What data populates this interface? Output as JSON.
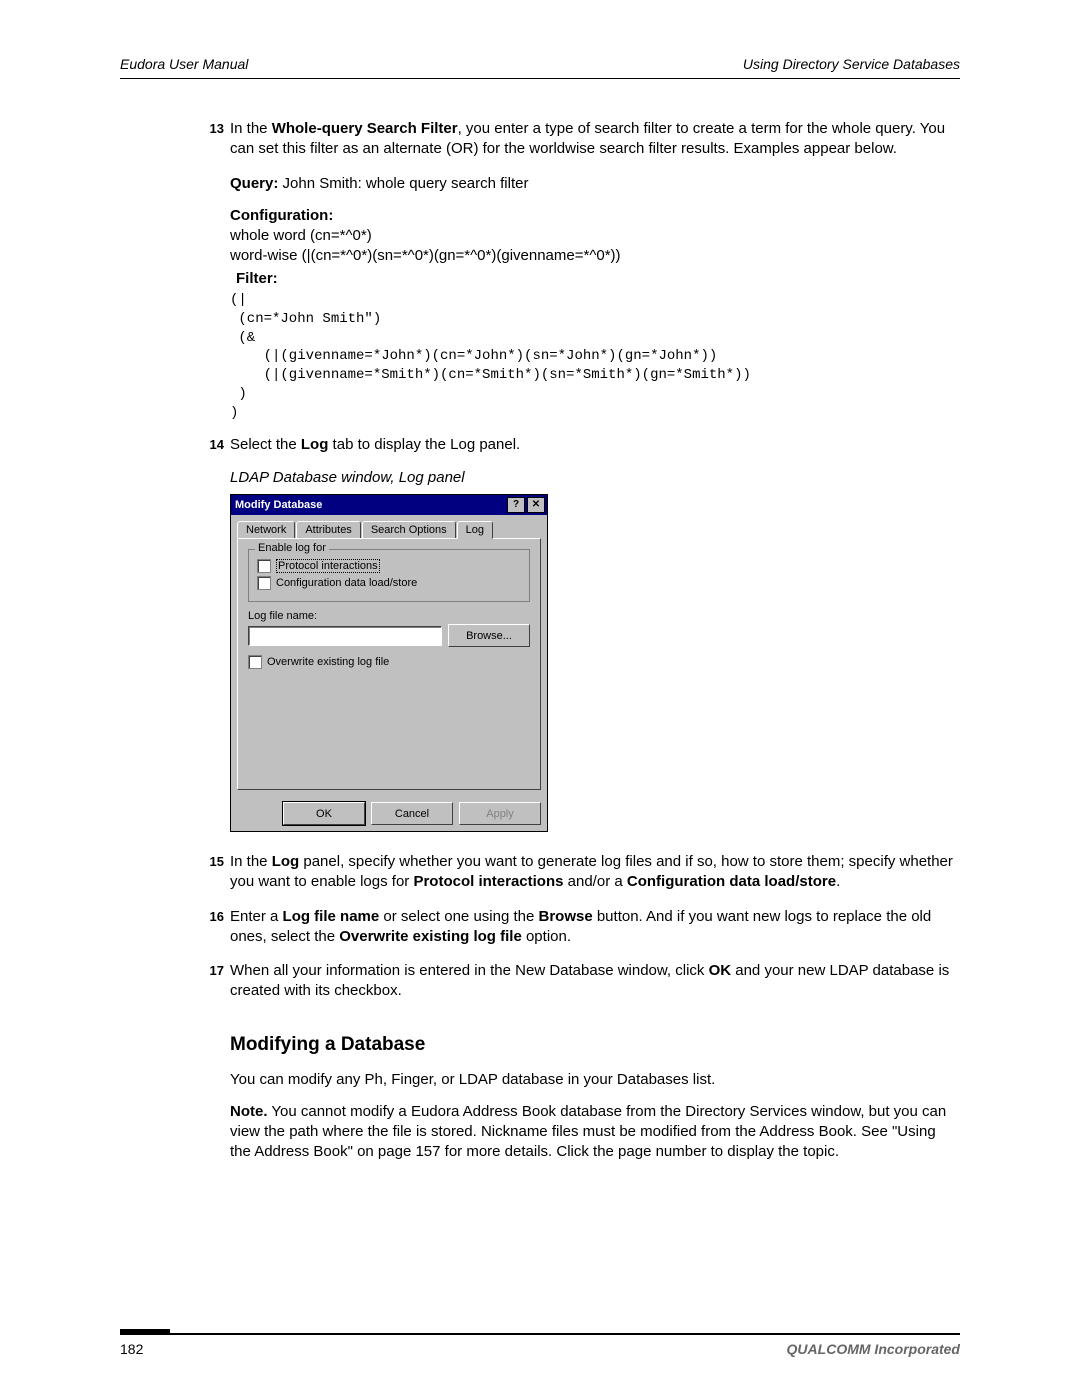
{
  "header": {
    "left": "Eudora User Manual",
    "right": "Using Directory Service Databases"
  },
  "steps": {
    "s13": {
      "num": "13",
      "text_pre": "In the ",
      "bold1": "Whole-query Search Filter",
      "text_post": ", you enter a type of search filter to create a term for the whole query. You can set this filter as an alternate (OR) for the worldwise search filter results. Examples appear below."
    },
    "query_line": {
      "label": "Query:",
      "text": " John Smith: whole query search filter"
    },
    "config_label": "Configuration:",
    "config_line1": "whole word (cn=*^0*)",
    "config_line2": "word-wise (|(cn=*^0*)(sn=*^0*)(gn=*^0*)(givenname=*^0*))",
    "filter_label": "Filter:",
    "filter_block": "(|\n (cn=*John Smith\")\n (&\n    (|(givenname=*John*)(cn=*John*)(sn=*John*)(gn=*John*))\n    (|(givenname=*Smith*)(cn=*Smith*)(sn=*Smith*)(gn=*Smith*))\n )\n)",
    "s14": {
      "num": "14",
      "pre": "Select the ",
      "bold": "Log",
      "post": " tab to display the Log panel."
    },
    "caption": "LDAP Database window, Log panel",
    "s15": {
      "num": "15",
      "pre": "In the ",
      "b1": "Log",
      "mid1": " panel, specify whether you want to generate log files and if so, how to store them; specify whether you want to enable logs for ",
      "b2": "Protocol interactions",
      "mid2": " and/or a ",
      "b3": "Configuration data load/store",
      "post": "."
    },
    "s16": {
      "num": "16",
      "pre": "Enter a ",
      "b1": "Log file name",
      "mid1": " or select one using the ",
      "b2": "Browse",
      "mid2": " button. And if you want new logs to replace the old ones, select the ",
      "b3": "Overwrite existing log file",
      "post": " option."
    },
    "s17": {
      "num": "17",
      "pre": "When all your information is entered in the New Database window, click ",
      "b1": "OK",
      "post": " and your new LDAP database is created with its checkbox."
    }
  },
  "dialog": {
    "title": "Modify Database",
    "help_glyph": "?",
    "close_glyph": "✕",
    "tabs": {
      "network": "Network",
      "attributes": "Attributes",
      "search": "Search Options",
      "log": "Log"
    },
    "groupbox": "Enable log for",
    "chk_protocol": "Protocol interactions",
    "chk_config": "Configuration data load/store",
    "logfile_label": "Log file name:",
    "browse": "Browse...",
    "overwrite": "Overwrite existing log file",
    "ok": "OK",
    "cancel": "Cancel",
    "apply": "Apply"
  },
  "section": {
    "heading": "Modifying a Database",
    "para1": "You can modify any Ph, Finger, or LDAP database in your Databases list.",
    "note_label": "Note.",
    "note_text": " You cannot modify a Eudora Address Book database from the Directory Services window, but you can view the path where the file is stored. Nickname files must be modified from the Address Book. See \"Using the Address Book\" on page 157 for more details. Click the page number to display the topic."
  },
  "footer": {
    "page": "182",
    "company": "QUALCOMM Incorporated"
  }
}
